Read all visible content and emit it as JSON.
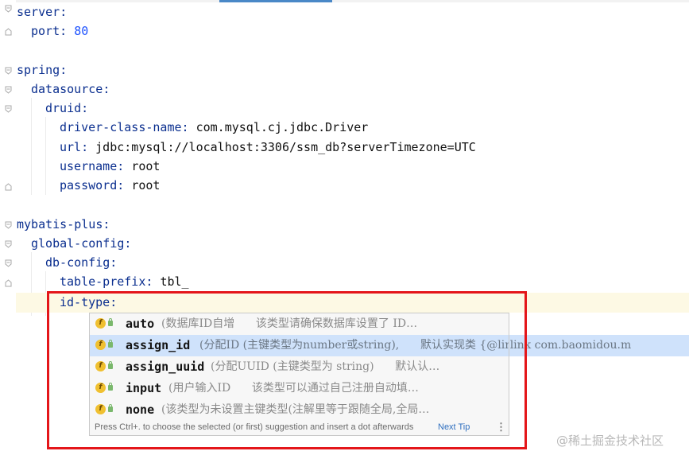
{
  "editor": {
    "lines": [
      {
        "key": "server",
        "sep": ":",
        "value": ""
      },
      {
        "key": "port",
        "sep": ": ",
        "value": "80"
      },
      {
        "key": "spring",
        "sep": ":",
        "value": ""
      },
      {
        "key": "datasource",
        "sep": ":",
        "value": ""
      },
      {
        "key": "druid",
        "sep": ":",
        "value": ""
      },
      {
        "key": "driver-class-name",
        "sep": ": ",
        "value": "com.mysql.cj.jdbc.Driver"
      },
      {
        "key": "url",
        "sep": ": ",
        "value": "jdbc:mysql://localhost:3306/ssm_db?serverTimezone=UTC"
      },
      {
        "key": "username",
        "sep": ": ",
        "value": "root"
      },
      {
        "key": "password",
        "sep": ": ",
        "value": "root"
      },
      {
        "key": "mybatis-plus",
        "sep": ":",
        "value": ""
      },
      {
        "key": "global-config",
        "sep": ":",
        "value": ""
      },
      {
        "key": "db-config",
        "sep": ":",
        "value": ""
      },
      {
        "key": "table-prefix",
        "sep": ": ",
        "value": "tbl_"
      },
      {
        "key": "id-type",
        "sep": ":",
        "value": ""
      }
    ]
  },
  "completion": {
    "items": [
      {
        "name": "auto",
        "desc": "(数据库ID自增      该类型请确保数据库设置了 ID…",
        "selected": false,
        "icon": "field-icon"
      },
      {
        "name": "assign_id",
        "desc": "(分配ID (主键类型为number或string),      默认实现类 {@link com.baomidou.m",
        "selected": true,
        "icon": "field-icon"
      },
      {
        "name": "assign_uuid",
        "desc": "(分配UUID (主键类型为 string)      默认认…",
        "selected": false,
        "icon": "field-icon"
      },
      {
        "name": "input",
        "desc": "(用户输入ID      该类型可以通过自己注册自动填…",
        "selected": false,
        "icon": "field-icon"
      },
      {
        "name": "none",
        "desc": "(该类型为未设置主键类型(注解里等于跟随全局,全局…",
        "selected": false,
        "icon": "field-icon"
      }
    ],
    "footer_hint": "Press Ctrl+. to choose the selected (or first) suggestion and insert a dot afterwards",
    "next_tip": "Next Tip",
    "more_icon": "more-vertical-icon"
  },
  "watermark": "@稀土掘金技术社区"
}
